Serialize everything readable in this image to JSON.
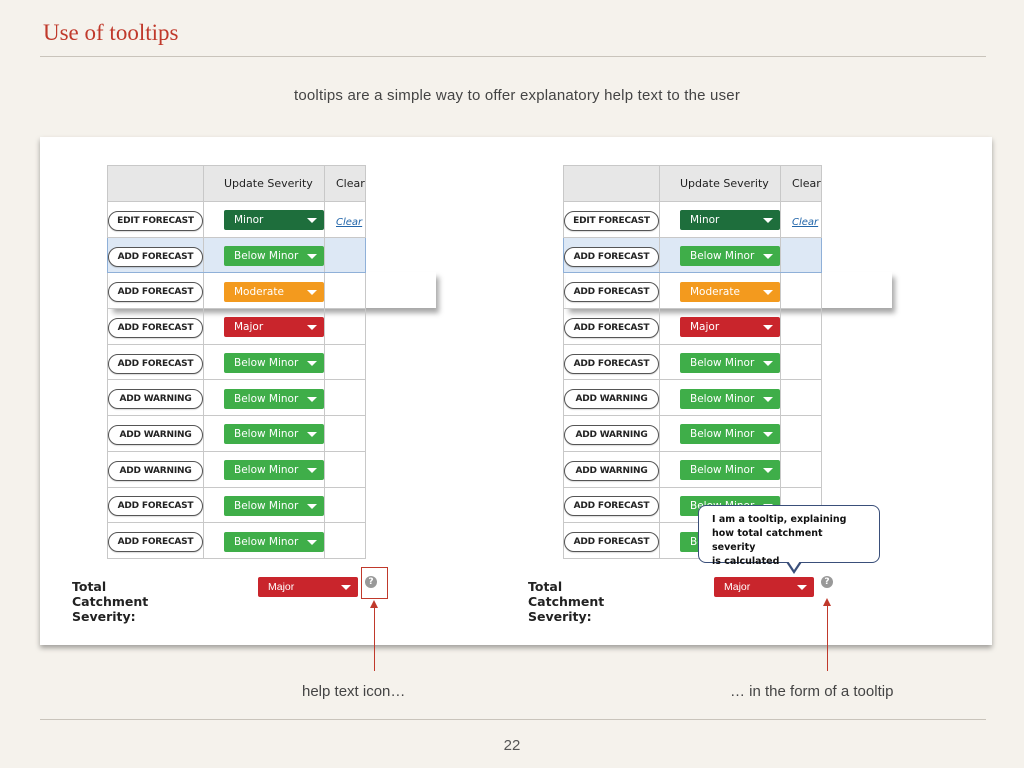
{
  "slide": {
    "title": "Use of tooltips",
    "subtitle": "tooltips are a simple way to offer explanatory help text to the user",
    "page_number": "22"
  },
  "mock_table": {
    "headers": [
      "",
      "Update Severity",
      "Clear"
    ],
    "rows": [
      {
        "action": "EDIT FORECAST",
        "severity": "Minor",
        "clear": "Clear"
      },
      {
        "action": "ADD FORECAST",
        "severity": "Below Minor",
        "clear": ""
      },
      {
        "action": "ADD FORECAST",
        "severity": "Moderate",
        "clear": ""
      },
      {
        "action": "ADD FORECAST",
        "severity": "Major",
        "clear": ""
      },
      {
        "action": "ADD FORECAST",
        "severity": "Below Minor",
        "clear": ""
      },
      {
        "action": "ADD WARNING",
        "severity": "Below Minor",
        "clear": ""
      },
      {
        "action": "ADD WARNING",
        "severity": "Below Minor",
        "clear": ""
      },
      {
        "action": "ADD WARNING",
        "severity": "Below Minor",
        "clear": ""
      },
      {
        "action": "ADD FORECAST",
        "severity": "Below Minor",
        "clear": ""
      },
      {
        "action": "ADD FORECAST",
        "severity": "Below Minor",
        "clear": ""
      }
    ],
    "total_label": "Total Catchment Severity:",
    "total_value": "Major",
    "help_icon_glyph": "?"
  },
  "severity_colors": {
    "Minor": "#1e6e3c",
    "Below Minor": "#3fae49",
    "Moderate": "#f39a1e",
    "Major": "#c9252c"
  },
  "tooltip": {
    "line1": "I am a tooltip, explaining",
    "line2": "how total catchment severity",
    "line3": "is calculated"
  },
  "captions": {
    "left": "help text icon…",
    "right": "… in the form of a tooltip"
  },
  "icons": {
    "help": "question-circle-icon",
    "dropdown": "caret-down-icon"
  }
}
